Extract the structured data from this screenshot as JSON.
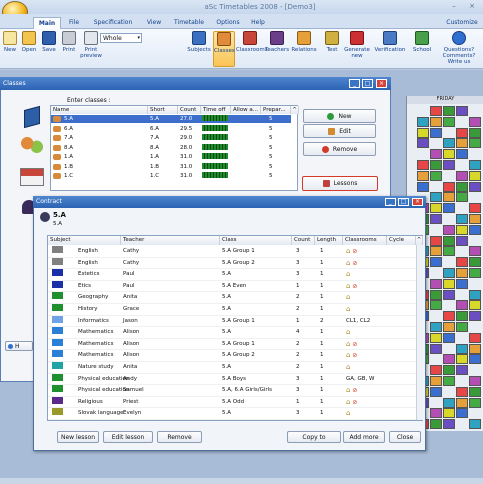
{
  "app": {
    "title": "aSc Timetables 2008 - [Demo3]",
    "customize": "Customize"
  },
  "tabs": [
    "Main",
    "File",
    "Specification",
    "View",
    "Timetable",
    "Options",
    "Help"
  ],
  "ribbon": {
    "new": "New",
    "open": "Open",
    "save": "Save",
    "print": "Print",
    "print_preview": "Print preview",
    "view_combo": "Whole",
    "subjects": "Subjects",
    "classes": "Classes",
    "classrooms": "Classrooms",
    "teachers": "Teachers",
    "relations": "Relations",
    "test": "Test",
    "generate_new": "Generate new",
    "verification": "Verification",
    "school": "School",
    "questions": "Questions?",
    "questions_sub": "Comments? Write us"
  },
  "classes_window": {
    "title": "Classes",
    "enter_label": "Enter classes :",
    "columns": [
      "Name",
      "Short",
      "Count",
      "Time off",
      "Allow a...",
      "Prepar..."
    ],
    "rows": [
      {
        "name": "5.A",
        "short": "5.A",
        "count": "27.0",
        "prep": "5"
      },
      {
        "name": "6.A",
        "short": "6.A",
        "count": "29.5",
        "prep": "5"
      },
      {
        "name": "7.A",
        "short": "7.A",
        "count": "29.0",
        "prep": "5"
      },
      {
        "name": "8.A",
        "short": "8.A",
        "count": "28.0",
        "prep": "5"
      },
      {
        "name": "1.A",
        "short": "1.A",
        "count": "31.0",
        "prep": "5"
      },
      {
        "name": "1.B",
        "short": "1.B",
        "count": "31.0",
        "prep": "5"
      },
      {
        "name": "1.C",
        "short": "1.C",
        "count": "31.0",
        "prep": "5"
      }
    ],
    "btn_new": "New",
    "btn_edit": "Edit",
    "btn_remove": "Remove",
    "btn_lessons": "Lessons",
    "help": "H"
  },
  "contract": {
    "title": "Contract",
    "class_name": "5.A",
    "class_short": "5.A",
    "columns": [
      "Subject",
      "Teacher",
      "Class",
      "Count",
      "Length",
      "Classrooms",
      "Cycle"
    ],
    "rows": [
      {
        "subject": "English",
        "teacher": "Cathy",
        "cls": "5.A Group 1",
        "count": "3",
        "length": "1",
        "rooms": "",
        "color": "#808080"
      },
      {
        "subject": "English",
        "teacher": "Cathy",
        "cls": "5.A Group 2",
        "count": "3",
        "length": "1",
        "rooms": "",
        "color": "#808080"
      },
      {
        "subject": "Estetics",
        "teacher": "Paul",
        "cls": "5.A",
        "count": "3",
        "length": "1",
        "rooms": "",
        "color": "#1b2fa8"
      },
      {
        "subject": "Etics",
        "teacher": "Paul",
        "cls": "5.A Even",
        "count": "1",
        "length": "1",
        "rooms": "",
        "color": "#1b2fa8"
      },
      {
        "subject": "Geography",
        "teacher": "Anita",
        "cls": "5.A",
        "count": "2",
        "length": "1",
        "rooms": "",
        "color": "#1f8f2f"
      },
      {
        "subject": "History",
        "teacher": "Grace",
        "cls": "5.A",
        "count": "2",
        "length": "1",
        "rooms": "",
        "color": "#1f8f2f"
      },
      {
        "subject": "Informatics",
        "teacher": "Jason",
        "cls": "5.A Group 1",
        "count": "1",
        "length": "2",
        "rooms": "CL1, CL2",
        "color": "#6fa3e6"
      },
      {
        "subject": "Mathematics",
        "teacher": "Alison",
        "cls": "5.A",
        "count": "4",
        "length": "1",
        "rooms": "",
        "color": "#2a7fd6"
      },
      {
        "subject": "Mathematics",
        "teacher": "Alison",
        "cls": "5.A Group 1",
        "count": "2",
        "length": "1",
        "rooms": "",
        "color": "#2a7fd6"
      },
      {
        "subject": "Mathematics",
        "teacher": "Alison",
        "cls": "5.A Group 2",
        "count": "2",
        "length": "1",
        "rooms": "",
        "color": "#2a7fd6"
      },
      {
        "subject": "Nature study",
        "teacher": "Anita",
        "cls": "5.A",
        "count": "2",
        "length": "1",
        "rooms": "",
        "color": "#1fa3a3"
      },
      {
        "subject": "Physical education",
        "teacher": "Andy",
        "cls": "5.A Boys",
        "count": "3",
        "length": "1",
        "rooms": "GA, GB, W",
        "color": "#1f8f2f"
      },
      {
        "subject": "Physical education",
        "teacher": "Samuel",
        "cls": "5.A, 6.A Girls/Girls",
        "count": "3",
        "length": "1",
        "rooms": "",
        "color": "#1f8f2f"
      },
      {
        "subject": "Religious",
        "teacher": "Priest",
        "cls": "5.A Odd",
        "count": "1",
        "length": "1",
        "rooms": "",
        "color": "#5a2a8a"
      },
      {
        "subject": "Slovak language",
        "teacher": "Evelyn",
        "cls": "5.A",
        "count": "3",
        "length": "1",
        "rooms": "",
        "color": "#9a9a2a"
      }
    ],
    "btn_new_lesson": "New lesson",
    "btn_edit_lesson": "Edit lesson",
    "btn_remove": "Remove",
    "btn_copy_to": "Copy to",
    "btn_add_more": "Add more",
    "btn_close": "Close"
  },
  "grid": {
    "header": "FRIDAY"
  }
}
